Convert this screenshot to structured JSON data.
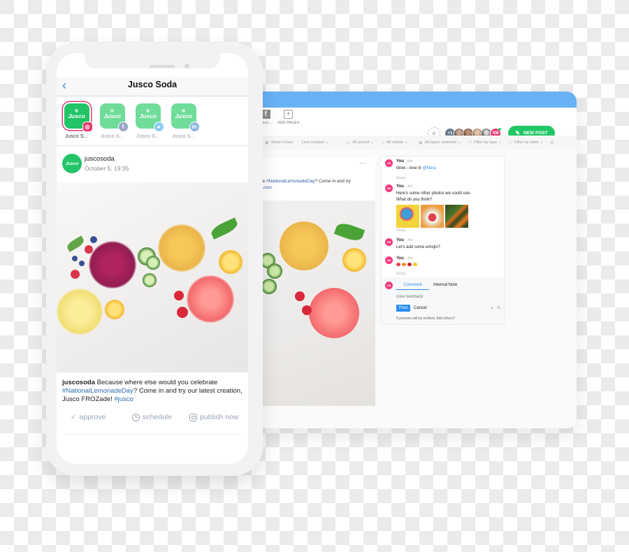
{
  "phone": {
    "nav": {
      "back_icon": "chevron-left-icon",
      "title": "Jusco Soda"
    },
    "accounts": [
      {
        "name": "Jusco S...",
        "logo_text": "Jusco",
        "network": "instagram",
        "network_glyph": "◎",
        "selected": true
      },
      {
        "name": "Jusco S...",
        "logo_text": "Jusco",
        "network": "facebook",
        "network_glyph": "f",
        "selected": false
      },
      {
        "name": "Jusco S...",
        "logo_text": "Jusco",
        "network": "twitter",
        "network_glyph": "🐦",
        "selected": false
      },
      {
        "name": "Jusco S...",
        "logo_text": "Jusco",
        "network": "linkedin",
        "network_glyph": "in",
        "selected": false
      }
    ],
    "post": {
      "avatar_text": "Jusco",
      "username": "juscosoda",
      "date": "October 5, 19:35",
      "caption_user": "juscosoda",
      "caption_text_1": " Because where else would you celebrate ",
      "caption_tag_1": "#NationalLemonadeDay",
      "caption_text_2": "? Come in and try our latest creation, Jusco FROZade! ",
      "caption_tag_2": "#jusco"
    },
    "actions": {
      "approve_icon": "✓",
      "approve": "approve",
      "schedule": "schedule",
      "publish": "publish now"
    }
  },
  "app": {
    "pages": [
      {
        "icon": "facebook-icon",
        "glyph": "f",
        "label": "Jusco ..."
      },
      {
        "icon": "add-icon",
        "glyph": "+",
        "label": "ADD PAGES"
      }
    ],
    "invite_glyph": "+",
    "avatars": {
      "more": "+1",
      "me": "XM"
    },
    "new_post": {
      "icon": "✎",
      "label": "NEW POST"
    },
    "filters": [
      {
        "icon": "◉",
        "label": "Show Cover"
      },
      {
        "icon": "⫶",
        "label": "Last created  ⌄"
      },
      {
        "icon": "▭",
        "label": "All period ⌄"
      },
      {
        "icon": "⌂",
        "label": "All visible ⌄"
      },
      {
        "icon": "◉",
        "label": "All types selected ⌄"
      },
      {
        "icon": "▽",
        "label": "Filter by type ⌄"
      },
      {
        "icon": "◇",
        "label": "Filter by label ⌄"
      },
      {
        "icon": "⚙",
        "label": ""
      }
    ],
    "post_preview": {
      "more": "···",
      "caption_pre": "ate ",
      "caption_tag": "#NationalLemonadeDay",
      "caption_post": "? Come in and try",
      "caption_tag_2": "#jusco"
    },
    "comments": [
      {
        "author": "You",
        "initials": "XM",
        "time": "6m",
        "text": "Wow - love it! ",
        "mention": "@Nora",
        "reply": "Reply"
      },
      {
        "author": "You",
        "initials": "XM",
        "time": "4m",
        "text_1": "Here's some other photos we could use.",
        "text_2": "What do you think?",
        "reply": "Reply"
      },
      {
        "author": "You",
        "initials": "XM",
        "time": "3m",
        "text": "Let's add some emojis?"
      },
      {
        "author": "You",
        "initials": "XM",
        "time": "3m",
        "emojis": [
          "watermelon",
          "peach",
          "apple",
          "lemon"
        ],
        "reply": "Reply"
      }
    ],
    "compose": {
      "initials": "XM",
      "tab_comment": "Comment",
      "tab_note": "Internal Note",
      "placeholder": "Give feedback",
      "post": "Post",
      "cancel": "Cancel",
      "attach_glyph": "⌀",
      "settings_glyph": "⚙",
      "notify": "0 persons will be notified. Add others?"
    }
  }
}
